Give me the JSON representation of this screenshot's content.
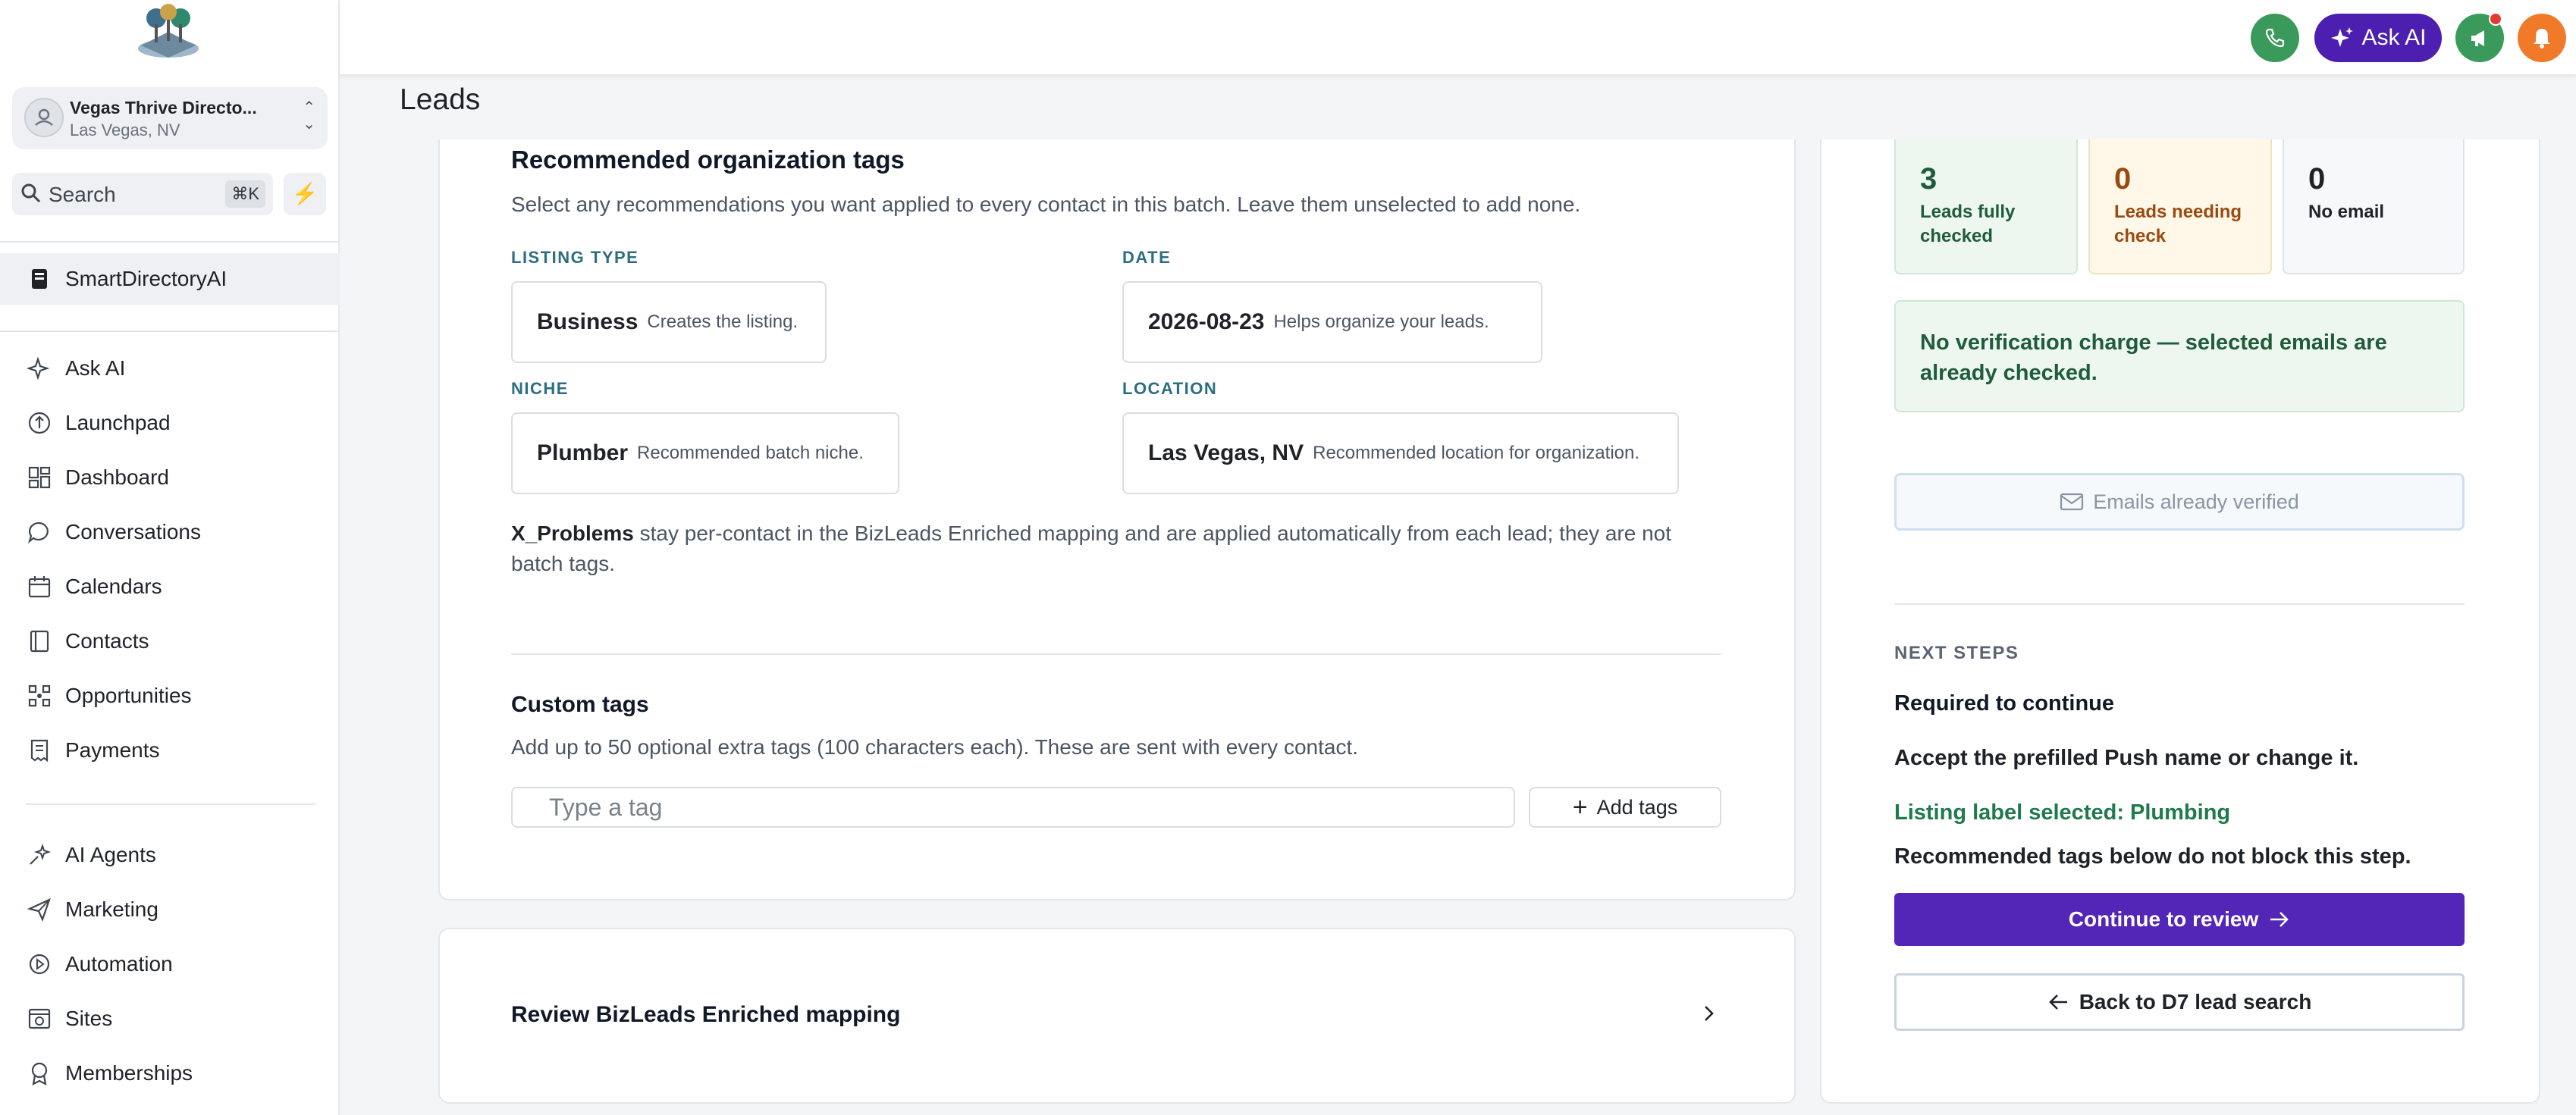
{
  "sidebar": {
    "account": {
      "name": "Vegas Thrive Directo...",
      "location": "Las Vegas, NV"
    },
    "search": {
      "label": "Search",
      "shortcut": "⌘K"
    },
    "active_item": "SmartDirectoryAI",
    "items": [
      {
        "label": "Ask AI",
        "icon": "sparkle-icon"
      },
      {
        "label": "Launchpad",
        "icon": "rocket-icon"
      },
      {
        "label": "Dashboard",
        "icon": "dashboard-grid-icon"
      },
      {
        "label": "Conversations",
        "icon": "chat-bubble-icon"
      },
      {
        "label": "Calendars",
        "icon": "calendar-icon"
      },
      {
        "label": "Contacts",
        "icon": "contacts-book-icon"
      },
      {
        "label": "Opportunities",
        "icon": "opportunities-icon"
      },
      {
        "label": "Payments",
        "icon": "receipt-icon"
      }
    ],
    "items2": [
      {
        "label": "AI Agents",
        "icon": "ai-agents-icon"
      },
      {
        "label": "Marketing",
        "icon": "paper-plane-icon"
      },
      {
        "label": "Automation",
        "icon": "automation-icon"
      },
      {
        "label": "Sites",
        "icon": "sites-icon"
      },
      {
        "label": "Memberships",
        "icon": "badge-icon"
      }
    ]
  },
  "topbar": {
    "ask_ai_label": "Ask AI"
  },
  "page": {
    "title": "Leads"
  },
  "main": {
    "rec_title": "Recommended organization tags",
    "rec_desc": "Select any recommendations you want applied to every contact in this batch. Leave them unselected to add none.",
    "fields": {
      "listing_type": {
        "label": "LISTING TYPE",
        "value": "Business",
        "desc": "Creates the listing."
      },
      "date": {
        "label": "DATE",
        "value": "2026-08-23",
        "desc": "Helps organize your leads."
      },
      "niche": {
        "label": "NICHE",
        "value": "Plumber",
        "desc": "Recommended batch niche."
      },
      "location": {
        "label": "LOCATION",
        "value": "Las Vegas, NV",
        "desc": "Recommended location for organization."
      }
    },
    "x_problems_bold": "X_Problems",
    "x_problems_line1": " stay per-contact in the BizLeads Enriched mapping and are applied automatically from each lead; they are not",
    "x_problems_line2": "batch tags.",
    "custom_title": "Custom tags",
    "custom_desc": "Add up to 50 optional extra tags (100 characters each). These are sent with every contact.",
    "tag_placeholder": "Type a tag",
    "add_tags_label": "Add tags",
    "mapping_title": "Review BizLeads Enriched mapping"
  },
  "right": {
    "stats": [
      {
        "value": "3",
        "label": "Leads fully checked"
      },
      {
        "value": "0",
        "label": "Leads needing check"
      },
      {
        "value": "0",
        "label": "No email"
      }
    ],
    "notice": "No verification charge — selected emails are already checked.",
    "emails_verified_label": "Emails already verified",
    "next_steps_label": "NEXT STEPS",
    "required": "Required to continue",
    "accept": "Accept the prefilled Push name or change it.",
    "listing_label": "Listing label selected: Plumbing",
    "recommended_note": "Recommended tags below do not block this step.",
    "continue_label": "Continue to review",
    "back_label": "Back to D7 lead search"
  },
  "colors": {
    "brand_purple": "#5426b8",
    "ask_ai_purple": "#4c1fb0",
    "success_green": "#1f7a4d",
    "warning_bg": "#fff8e8",
    "phone_green": "#3a9a5b",
    "bell_orange": "#f07a2a"
  }
}
